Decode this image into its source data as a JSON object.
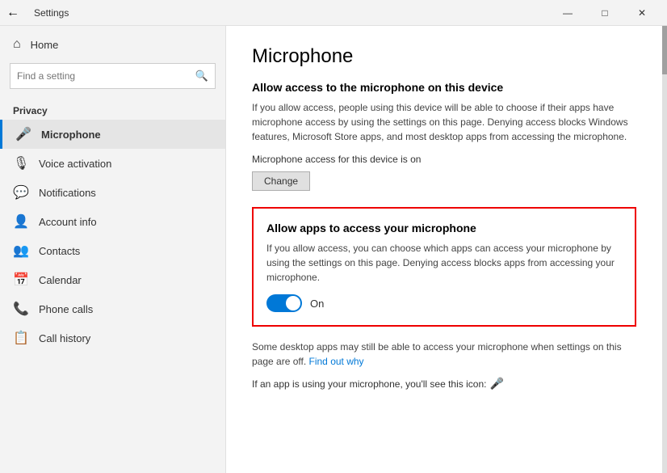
{
  "titlebar": {
    "back_icon": "←",
    "title": "Settings",
    "minimize_label": "—",
    "maximize_label": "□",
    "close_label": "✕"
  },
  "sidebar": {
    "back_label": "",
    "home_label": "Home",
    "home_icon": "⌂",
    "search_placeholder": "Find a setting",
    "search_icon": "🔍",
    "section_label": "Privacy",
    "items": [
      {
        "id": "microphone",
        "label": "Microphone",
        "icon": "🎤",
        "active": true
      },
      {
        "id": "voice-activation",
        "label": "Voice activation",
        "icon": "🎙",
        "active": false
      },
      {
        "id": "notifications",
        "label": "Notifications",
        "icon": "💬",
        "active": false
      },
      {
        "id": "account-info",
        "label": "Account info",
        "icon": "👤",
        "active": false
      },
      {
        "id": "contacts",
        "label": "Contacts",
        "icon": "👥",
        "active": false
      },
      {
        "id": "calendar",
        "label": "Calendar",
        "icon": "📅",
        "active": false
      },
      {
        "id": "phone-calls",
        "label": "Phone calls",
        "icon": "📞",
        "active": false
      },
      {
        "id": "call-history",
        "label": "Call history",
        "icon": "📋",
        "active": false
      }
    ]
  },
  "content": {
    "page_title": "Microphone",
    "device_access": {
      "heading": "Allow access to the microphone on this device",
      "description": "If you allow access, people using this device will be able to choose if their apps have microphone access by using the settings on this page. Denying access blocks Windows features, Microsoft Store apps, and most desktop apps from accessing the microphone.",
      "status_text": "Microphone access for this device is on",
      "change_button": "Change"
    },
    "app_access": {
      "heading": "Allow apps to access your microphone",
      "description": "If you allow access, you can choose which apps can access your microphone by using the settings on this page. Denying access blocks apps from accessing your microphone.",
      "toggle_state": "On",
      "toggle_on": true
    },
    "desktop_note": {
      "text": "Some desktop apps may still be able to access your microphone when settings on this page are off.",
      "link_text": "Find out why"
    },
    "icon_note": {
      "prefix": "If an app is using your microphone, you'll see this icon:",
      "icon": "🎤"
    }
  }
}
